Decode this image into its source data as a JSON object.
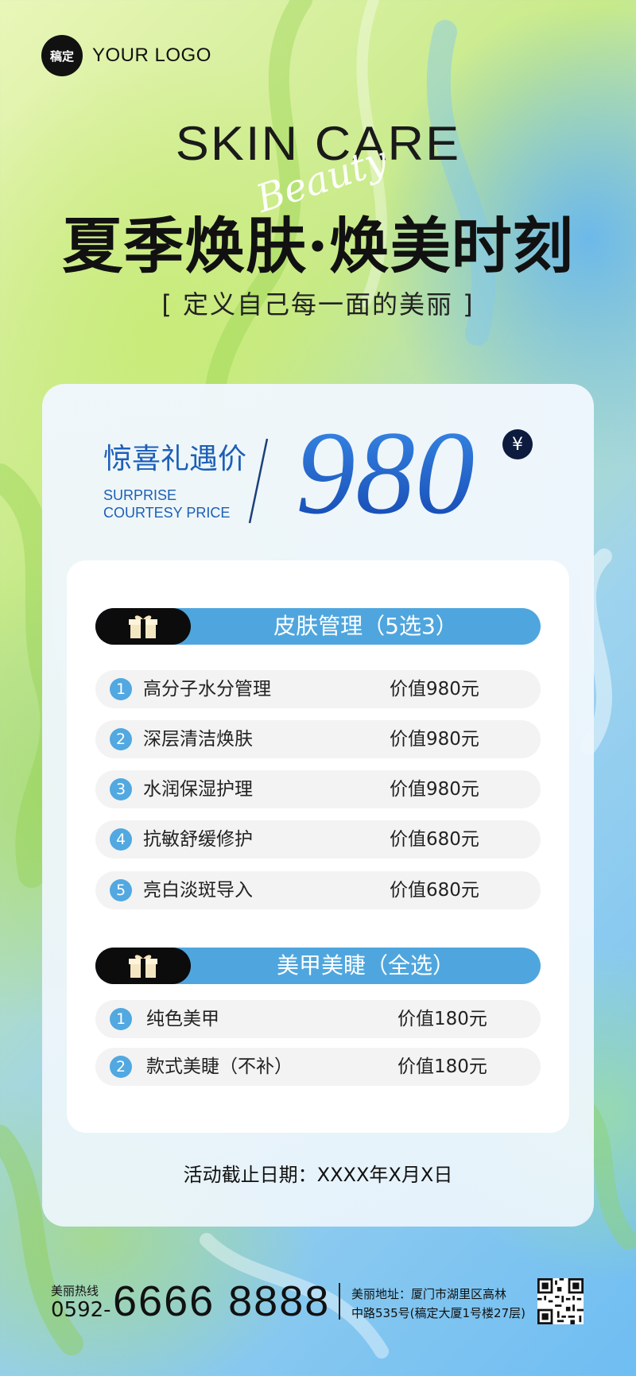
{
  "logo": {
    "badge": "稿定",
    "text": "YOUR LOGO"
  },
  "hero": {
    "title_en": "SKIN CARE",
    "script_word": "Beauty",
    "headline": "夏季焕肤·焕美时刻",
    "subtitle": "[ 定义自己每一面的美丽 ]"
  },
  "price": {
    "label_cn": "惊喜礼遇价",
    "label_en_line1": "SURPRISE",
    "label_en_line2": "COURTESY PRICE",
    "value": "980",
    "currency": "¥"
  },
  "sections": [
    {
      "title": "皮肤管理（5选3）",
      "items": [
        {
          "num": "1",
          "name": "高分子水分管理",
          "value": "价值980元"
        },
        {
          "num": "2",
          "name": "深层清洁焕肤",
          "value": "价值980元"
        },
        {
          "num": "3",
          "name": "水润保湿护理",
          "value": "价值980元"
        },
        {
          "num": "4",
          "name": "抗敏舒缓修护",
          "value": "价值680元"
        },
        {
          "num": "5",
          "name": "亮白淡斑导入",
          "value": "价值680元"
        }
      ]
    },
    {
      "title": "美甲美睫（全选）",
      "items": [
        {
          "num": "1",
          "name": "纯色美甲",
          "value": "价值180元"
        },
        {
          "num": "2",
          "name": "款式美睫（不补）",
          "value": "价值180元"
        }
      ]
    }
  ],
  "deadline": "活动截止日期：XXXX年X月X日",
  "footer": {
    "hotline_label": "美丽热线",
    "area_code": "0592-",
    "phone": "6666 8888",
    "address_line1": "美丽地址：厦门市湖里区高林",
    "address_line2": "中路535号(稿定大厦1号楼27层)"
  },
  "colors": {
    "accent_blue": "#4fa6de",
    "price_blue": "#1f5fc9",
    "label_blue": "#1d5fb8",
    "dark": "#0c0c0c"
  }
}
